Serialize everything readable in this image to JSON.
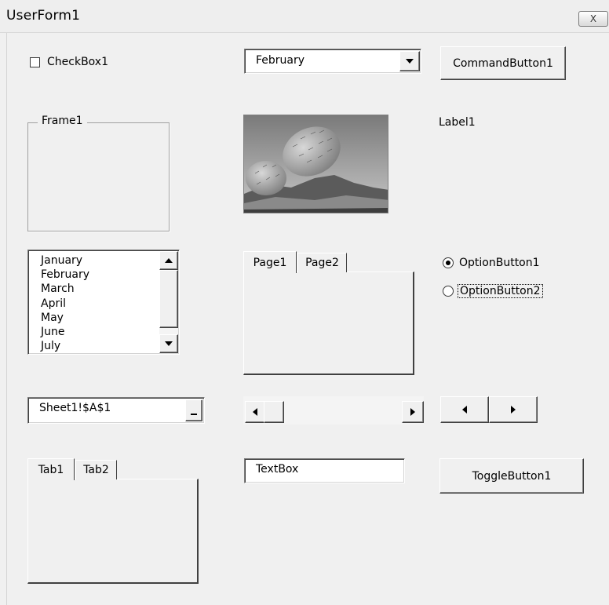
{
  "window": {
    "title": "UserForm1",
    "close_glyph": "X"
  },
  "checkbox": {
    "label": "CheckBox1",
    "checked": false
  },
  "combobox": {
    "value": "February"
  },
  "command_button": {
    "label": "CommandButton1"
  },
  "frame": {
    "caption": "Frame1"
  },
  "image": {
    "icon": "cactus-photo"
  },
  "label": {
    "text": "Label1"
  },
  "listbox": {
    "items": [
      "January",
      "February",
      "March",
      "April",
      "May",
      "June",
      "July"
    ]
  },
  "multipage": {
    "tabs": [
      "Page1",
      "Page2"
    ],
    "selected": "Page1"
  },
  "option_buttons": [
    {
      "label": "OptionButton1",
      "selected": true
    },
    {
      "label": "OptionButton2",
      "selected": false,
      "focused": true
    }
  ],
  "refedit": {
    "value": "Sheet1!$A$1",
    "button_glyph": "_"
  },
  "tabstrip": {
    "tabs": [
      "Tab1",
      "Tab2"
    ],
    "selected": "Tab1"
  },
  "textbox": {
    "value": "TextBox"
  },
  "toggle_button": {
    "label": "ToggleButton1"
  }
}
